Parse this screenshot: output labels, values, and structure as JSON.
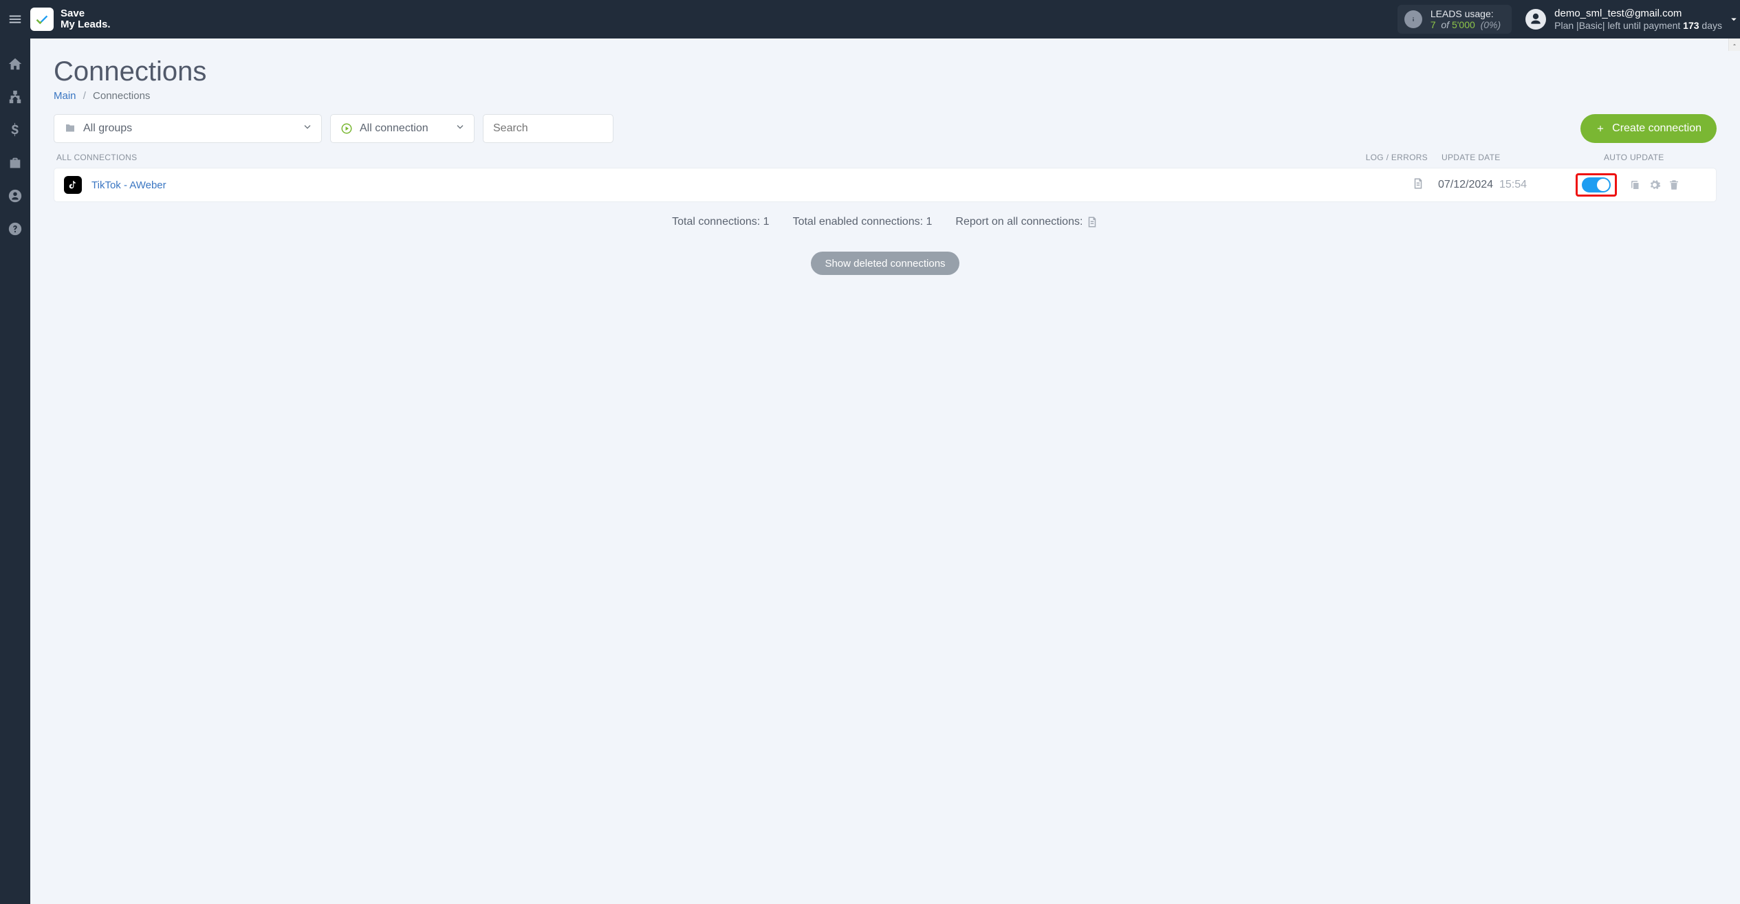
{
  "brand": {
    "line1": "Save",
    "line2": "My Leads."
  },
  "leads_usage": {
    "label": "LEADS usage:",
    "used": "7",
    "of_word": "of",
    "total": "5'000",
    "percent": "(0%)"
  },
  "account": {
    "email": "demo_sml_test@gmail.com",
    "plan_prefix": "Plan |",
    "plan_name": "Basic",
    "plan_mid": "| left until payment ",
    "days_number": "173",
    "days_word": " days"
  },
  "page": {
    "title": "Connections",
    "breadcrumb_home": "Main",
    "breadcrumb_current": "Connections"
  },
  "filters": {
    "groups_label": "All groups",
    "status_label": "All connection",
    "search_placeholder": "Search",
    "create_btn": "Create connection"
  },
  "columns": {
    "name": "ALL CONNECTIONS",
    "log": "LOG / ERRORS",
    "date": "UPDATE DATE",
    "auto": "AUTO UPDATE"
  },
  "rows": [
    {
      "icon": "tiktok",
      "name": "TikTok - AWeber",
      "date": "07/12/2024",
      "time": "15:54",
      "auto_on": true
    }
  ],
  "summary": {
    "total_label": "Total connections: ",
    "total_value": "1",
    "enabled_label": "Total enabled connections: ",
    "enabled_value": "1",
    "report_label": "Report on all connections: "
  },
  "show_deleted_btn": "Show deleted connections",
  "sidebar_items": [
    "home",
    "sitemap",
    "dollar",
    "briefcase",
    "user",
    "help"
  ]
}
